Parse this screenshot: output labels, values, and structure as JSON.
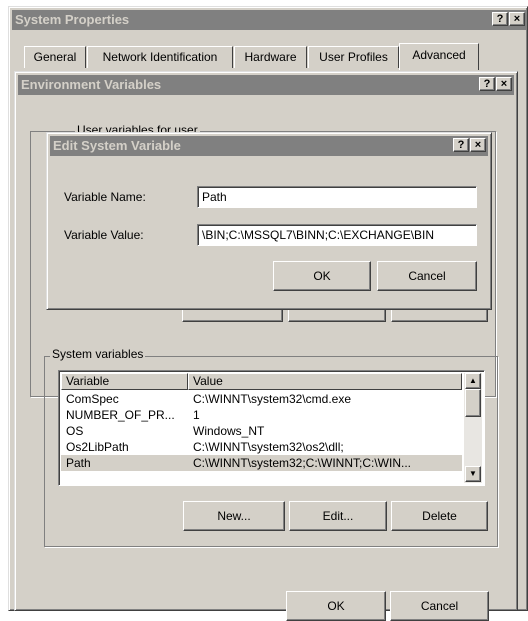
{
  "system_properties": {
    "title": "System Properties",
    "help_btn": "?",
    "close_btn": "×",
    "tabs": [
      "General",
      "Network Identification",
      "Hardware",
      "User Profiles",
      "Advanced"
    ],
    "active_tab": "Advanced"
  },
  "env_vars": {
    "title": "Environment Variables",
    "help_btn": "?",
    "close_btn": "×",
    "user_group_label_fragment": "User variables for user",
    "system_group_label": "System variables",
    "columns": [
      "Variable",
      "Value"
    ],
    "rows": [
      {
        "variable": "ComSpec",
        "value": "C:\\WINNT\\system32\\cmd.exe"
      },
      {
        "variable": "NUMBER_OF_PR...",
        "value": "1"
      },
      {
        "variable": "OS",
        "value": "Windows_NT"
      },
      {
        "variable": "Os2LibPath",
        "value": "C:\\WINNT\\system32\\os2\\dll;"
      },
      {
        "variable": "Path",
        "value": "C:\\WINNT\\system32;C:\\WINNT;C:\\WIN..."
      }
    ],
    "selected_row": "Path",
    "buttons": {
      "new": "New...",
      "edit": "Edit...",
      "delete": "Delete"
    },
    "ok": "OK",
    "cancel": "Cancel"
  },
  "edit_dialog": {
    "title": "Edit System Variable",
    "help_btn": "?",
    "close_btn": "×",
    "name_label": "Variable Name:",
    "name_value": "Path",
    "value_label": "Variable Value:",
    "value_value": "\\BIN;C:\\MSSQL7\\BINN;C:\\EXCHANGE\\BIN",
    "ok": "OK",
    "cancel": "Cancel"
  },
  "colors": {
    "face": "#d4d0c8",
    "inactive_title": "#808080",
    "shadow": "#808080",
    "highlight": "#ffffff"
  },
  "icons": [
    "help-icon",
    "close-icon",
    "scroll-up-arrow-icon",
    "scroll-down-arrow-icon"
  ]
}
